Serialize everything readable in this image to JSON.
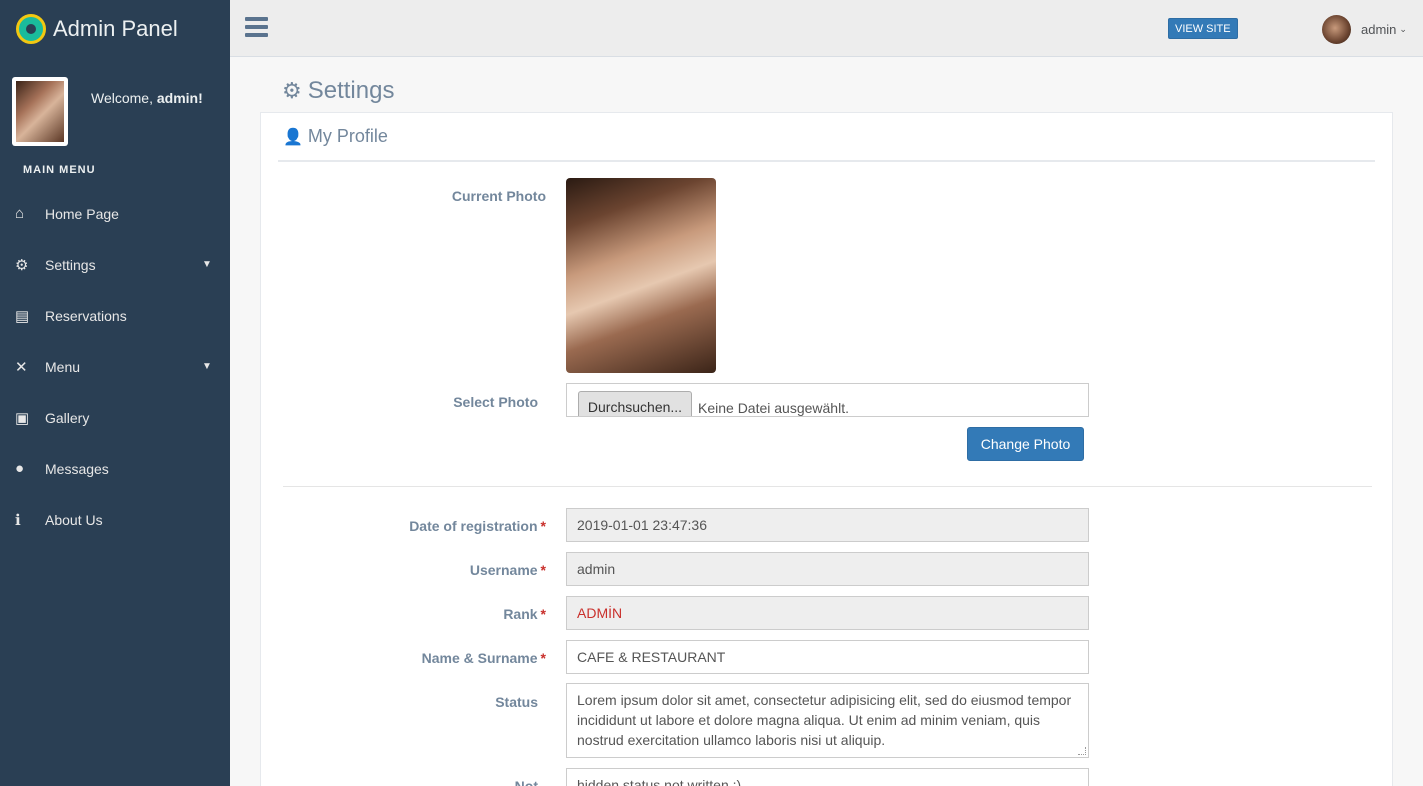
{
  "brand": {
    "title": "Admin Panel",
    "logo_icon": "gear-logo-icon"
  },
  "sidebar": {
    "welcome_prefix": "Welcome,",
    "welcome_user": "admin!",
    "menu_title": "MAIN MENU",
    "items": [
      {
        "label": "Home Page",
        "icon": "home-icon",
        "glyph": "⌂"
      },
      {
        "label": "Settings",
        "icon": "cogs-icon",
        "glyph": "⚙",
        "has_children": true
      },
      {
        "label": "Reservations",
        "icon": "book-icon",
        "glyph": "▤"
      },
      {
        "label": "Menu",
        "icon": "cutlery-icon",
        "glyph": "🍴",
        "has_children": true
      },
      {
        "label": "Gallery",
        "icon": "image-icon",
        "glyph": "▣"
      },
      {
        "label": "Messages",
        "icon": "comments-icon",
        "glyph": "💬"
      },
      {
        "label": "About Us",
        "icon": "info-icon",
        "glyph": "ℹ"
      }
    ]
  },
  "topbar": {
    "view_site_label": "VIEW SITE",
    "user_name": "admin"
  },
  "page": {
    "title": "Settings",
    "panel_title": "My Profile"
  },
  "form": {
    "current_photo_label": "Current Photo",
    "select_photo_label": "Select Photo",
    "file_button_label": "Durchsuchen...",
    "file_status": "Keine Datei ausgewählt.",
    "change_photo_label": "Change Photo",
    "fields": {
      "registration": {
        "label": "Date of registration",
        "value": "2019-01-01 23:47:36",
        "required": "*"
      },
      "username": {
        "label": "Username",
        "value": "admin",
        "required": "*"
      },
      "rank": {
        "label": "Rank",
        "value": "ADMİN",
        "required": "*"
      },
      "name": {
        "label": "Name & Surname",
        "value": "CAFE & RESTAURANT",
        "required": "*"
      },
      "status": {
        "label": "Status",
        "value": "Lorem ipsum dolor sit amet, consectetur adipisicing elit, sed do eiusmod tempor incididunt ut labore et dolore magna aliqua. Ut enim ad minim veniam, quis nostrud exercitation ullamco laboris nisi ut aliquip."
      },
      "not": {
        "label": "Not",
        "value": "hidden status not written :)"
      }
    }
  },
  "colors": {
    "sidebar_bg": "#2a3f54",
    "primary": "#337ab7",
    "required": "#c9302c"
  }
}
